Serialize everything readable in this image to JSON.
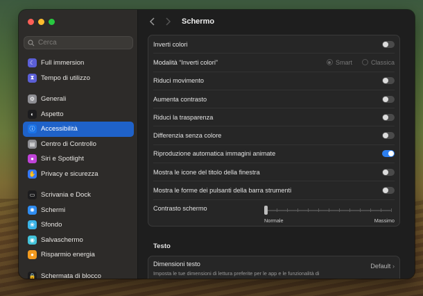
{
  "window": {
    "title": "Schermo"
  },
  "search": {
    "placeholder": "Cerca"
  },
  "sidebar": {
    "items": [
      {
        "label": "Full immersion",
        "icon": "moon-icon",
        "color": "#5b5fd6"
      },
      {
        "label": "Tempo di utilizzo",
        "icon": "hourglass-icon",
        "color": "#5b5fd6"
      },
      {
        "label": "Generali",
        "icon": "gear-icon",
        "color": "#8e8e93"
      },
      {
        "label": "Aspetto",
        "icon": "appearance-icon",
        "color": "#1c1c1e"
      },
      {
        "label": "Accessibilità",
        "icon": "accessibility-icon",
        "color": "#1a73e8",
        "selected": true
      },
      {
        "label": "Centro di Controllo",
        "icon": "control-center-icon",
        "color": "#8e8e93"
      },
      {
        "label": "Siri e Spotlight",
        "icon": "siri-icon",
        "color": "#c044d8"
      },
      {
        "label": "Privacy e sicurezza",
        "icon": "hand-icon",
        "color": "#3478f6"
      },
      {
        "label": "Scrivania e Dock",
        "icon": "dock-icon",
        "color": "#1c1c1e"
      },
      {
        "label": "Schermi",
        "icon": "sun-icon",
        "color": "#2f8cf0"
      },
      {
        "label": "Sfondo",
        "icon": "wallpaper-icon",
        "color": "#3ab3e6"
      },
      {
        "label": "Salvaschermo",
        "icon": "screensaver-icon",
        "color": "#43c2d9"
      },
      {
        "label": "Risparmio energia",
        "icon": "bulb-icon",
        "color": "#f29a1f"
      },
      {
        "label": "Schermata di blocco",
        "icon": "lock-icon",
        "color": "#1c1c1e"
      }
    ]
  },
  "settings": {
    "rows": [
      {
        "label": "Inverti colori",
        "type": "toggle",
        "on": false
      },
      {
        "label": "Modalità “Inverti colori”",
        "type": "radio",
        "options": [
          "Smart",
          "Classica"
        ]
      },
      {
        "label": "Riduci movimento",
        "type": "toggle",
        "on": false
      },
      {
        "label": "Aumenta contrasto",
        "type": "toggle",
        "on": false
      },
      {
        "label": "Riduci la trasparenza",
        "type": "toggle",
        "on": false
      },
      {
        "label": "Differenzia senza colore",
        "type": "toggle",
        "on": false
      },
      {
        "label": "Riproduzione automatica immagini animate",
        "type": "toggle",
        "on": true
      },
      {
        "label": "Mostra le icone del titolo della finestra",
        "type": "toggle",
        "on": false
      },
      {
        "label": "Mostra le forme dei pulsanti della barra strumenti",
        "type": "toggle",
        "on": false
      }
    ],
    "contrast": {
      "label": "Contrasto schermo",
      "min_label": "Normale",
      "max_label": "Massimo",
      "value": 0
    }
  },
  "text_section": {
    "heading": "Testo",
    "title": "Dimensioni testo",
    "subtitle": "Imposta le tue dimensioni di lettura preferite per le app e le funzionalità di",
    "value": "Default"
  }
}
